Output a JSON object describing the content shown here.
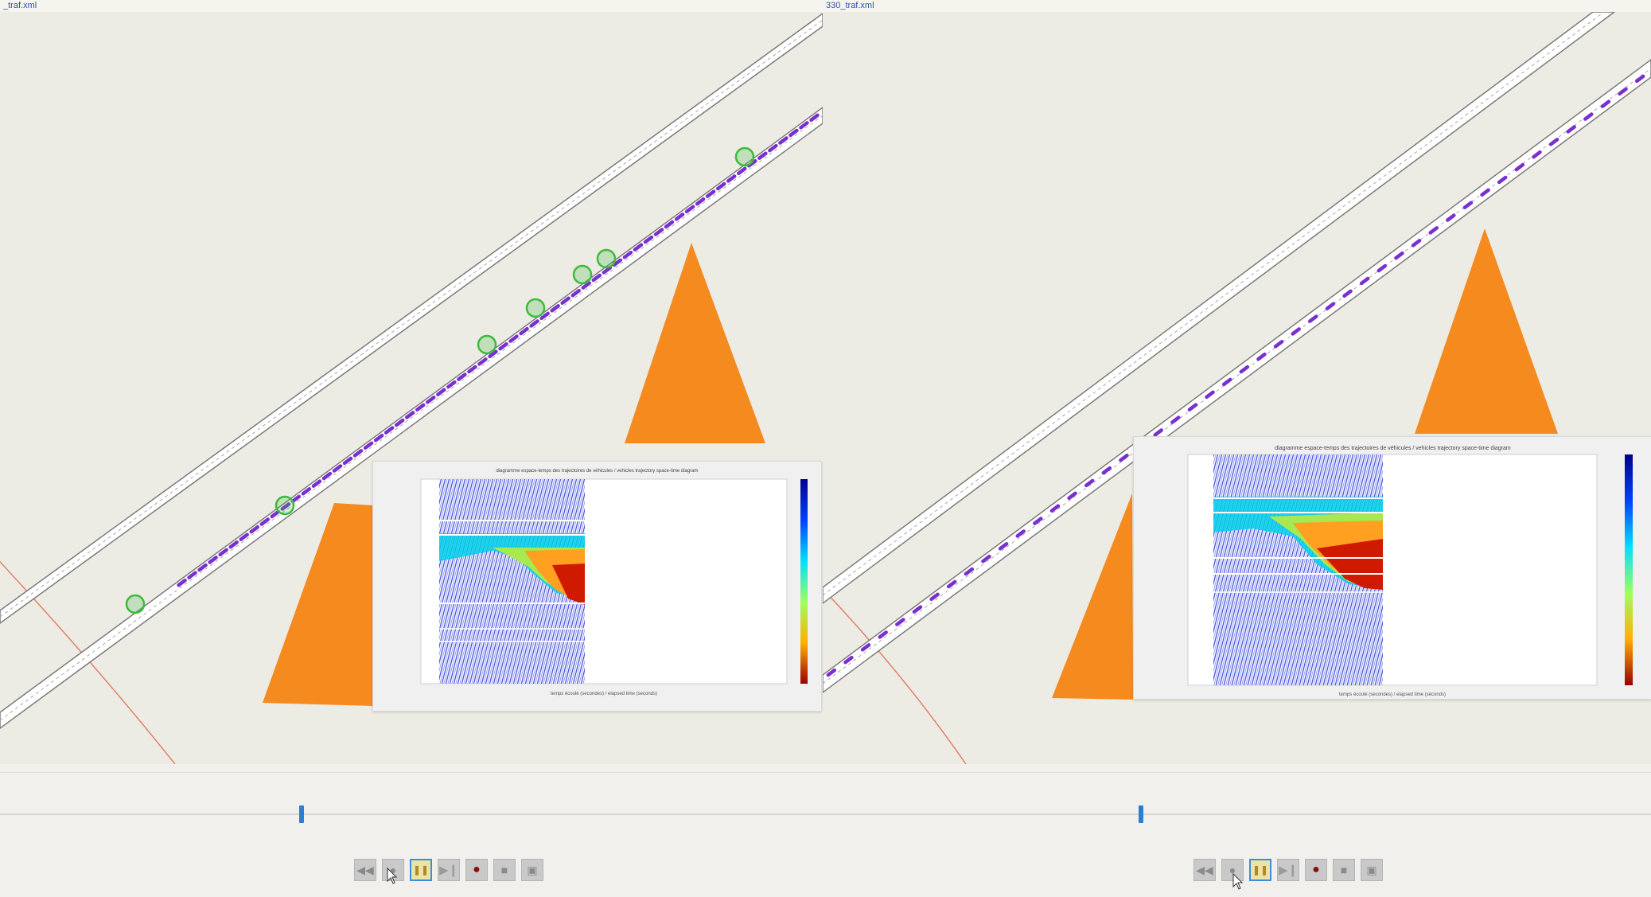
{
  "left_panel": {
    "title": "_traf.xml",
    "slider_position": 0.18
  },
  "right_panel": {
    "title": "330_traf.xml",
    "slider_position": 0.69
  },
  "diagram": {
    "title": "diagramme espace-temps des trajectoires de véhicules / vehicles trajectory space-time diagram",
    "xlabel": "temps écoulé (secondes) / elapsed time (seconds)",
    "colormap": "jet"
  },
  "controls": {
    "rewind_icon": "rewind-icon",
    "stop_icon": "stop-icon",
    "pause_icon": "pause-icon",
    "play_icon": "play-icon",
    "record_icon": "record-icon",
    "step_icon": "step-icon",
    "end_icon": "end-icon"
  },
  "colors": {
    "background": "#ecebe4",
    "vehicle": "#7a2fd0",
    "marker": "#3dbb3d",
    "cone": "#f58a1f",
    "boundary": "#e0826a",
    "slider": "#2a7fd0",
    "pause_highlight": "#3d8ee0"
  }
}
